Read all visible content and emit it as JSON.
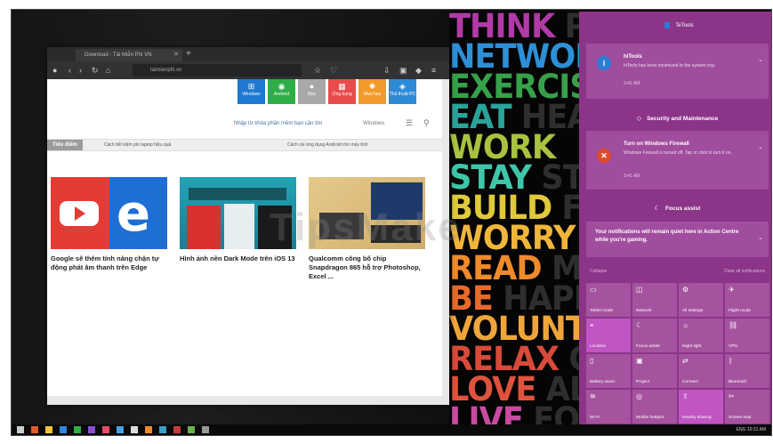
{
  "browser": {
    "tab_title": "Download - Tải Miễn Phí VN",
    "address": "taimienphi.vn",
    "menu_tiles": [
      {
        "label": "Windows",
        "color": "#1f78d1",
        "icon": "windows-icon"
      },
      {
        "label": "Android",
        "color": "#2fae48",
        "icon": "android-icon"
      },
      {
        "label": "Mac",
        "color": "#a8a8a8",
        "icon": "apple-icon"
      },
      {
        "label": "Ứng dụng",
        "color": "#e94b4b",
        "icon": "apps-icon"
      },
      {
        "label": "Mẹo hay",
        "color": "#f39a2b",
        "icon": "lightbulb-icon"
      },
      {
        "label": "Thủ thuật PC",
        "color": "#2d8ad6",
        "icon": "pc-icon"
      }
    ],
    "search_text": "Nhập từ khóa phần mềm bạn cần tìm",
    "lang_text": "Windows",
    "ticker": {
      "label": "Tiêu điểm",
      "items": [
        "Cách tiết kiệm pin laptop hiệu quả",
        "Cách cài ứng dụng Android cho máy tính"
      ]
    },
    "cards": [
      {
        "title": "Google sẽ thêm tính năng chặn tự động phát âm thanh trên Edge"
      },
      {
        "title": "Hình ảnh nền Dark Mode trên iOS 13"
      },
      {
        "title": "Qualcomm công bố chip Snapdragon 865 hỗ trợ Photoshop, Excel ..."
      }
    ]
  },
  "wallpaper": {
    "words": [
      "THINK",
      "NETWORK",
      "EXERCISE",
      "EAT",
      "WORK",
      "STAY",
      "BUILD",
      "WORRY",
      "READ",
      "BE",
      "VOLUNT",
      "RELAX",
      "LOVE",
      "LIVE"
    ],
    "ghosts": [
      "PO",
      "",
      "",
      "HEAL",
      "",
      "STR",
      "FA",
      "",
      "MO",
      "HAPPY",
      "",
      "CR",
      "AL",
      "FOR"
    ],
    "colors": [
      "#b13aa8",
      "#2d8fd6",
      "#36a14a",
      "#2aa39a",
      "#a9c23f",
      "#3ec6a8",
      "#e0c93a",
      "#f0b63a",
      "#f08a2a",
      "#e86a2a",
      "#f0a53a",
      "#d84a3a",
      "#e0523e",
      "#c94aa0"
    ]
  },
  "watermark": "TipsMake",
  "action_center": {
    "header": "TeTools",
    "notifications": [
      {
        "title": "hiTools",
        "body": "hiTools has been minimized to the system tray.",
        "time": "3:41 AM",
        "icon": "info-icon"
      },
      {
        "title": "Turn on Windows Firewall",
        "body": "Windows Firewall is turned off. Tap or click to turn it on.",
        "time": "3:41 AM",
        "icon": "shield-x-icon"
      },
      {
        "title": "Your notifications will remain quiet here in Action Centre while you're gaming.",
        "body": "",
        "time": "",
        "icon": ""
      }
    ],
    "groups": {
      "security": "Security and Maintenance",
      "focus": "Focus assist"
    },
    "footer_left": "Collapse",
    "footer_right": "Clear all notifications",
    "quick_actions": [
      {
        "label": "Tablet mode",
        "icon": "tablet-icon",
        "on": false
      },
      {
        "label": "Network",
        "icon": "network-icon",
        "on": false
      },
      {
        "label": "All settings",
        "icon": "gear-icon",
        "on": false
      },
      {
        "label": "Flight mode",
        "icon": "airplane-icon",
        "on": false
      },
      {
        "label": "Location",
        "icon": "location-icon",
        "on": true
      },
      {
        "label": "Focus assist",
        "icon": "moon-icon",
        "on": false
      },
      {
        "label": "Night light",
        "icon": "sun-icon",
        "on": false
      },
      {
        "label": "VPN",
        "icon": "vpn-icon",
        "on": false
      },
      {
        "label": "Battery saver",
        "icon": "battery-icon",
        "on": false
      },
      {
        "label": "Project",
        "icon": "project-icon",
        "on": false
      },
      {
        "label": "Connect",
        "icon": "connect-icon",
        "on": false
      },
      {
        "label": "Bluetooth",
        "icon": "bluetooth-icon",
        "on": false
      },
      {
        "label": "Wi-Fi",
        "icon": "wifi-icon",
        "on": false
      },
      {
        "label": "Mobile hotspot",
        "icon": "hotspot-icon",
        "on": false
      },
      {
        "label": "Nearby sharing",
        "icon": "share-icon",
        "on": true
      },
      {
        "label": "Screen snip",
        "icon": "snip-icon",
        "on": false
      }
    ]
  },
  "taskbar": {
    "tray": "ENG  10:21 AM"
  }
}
